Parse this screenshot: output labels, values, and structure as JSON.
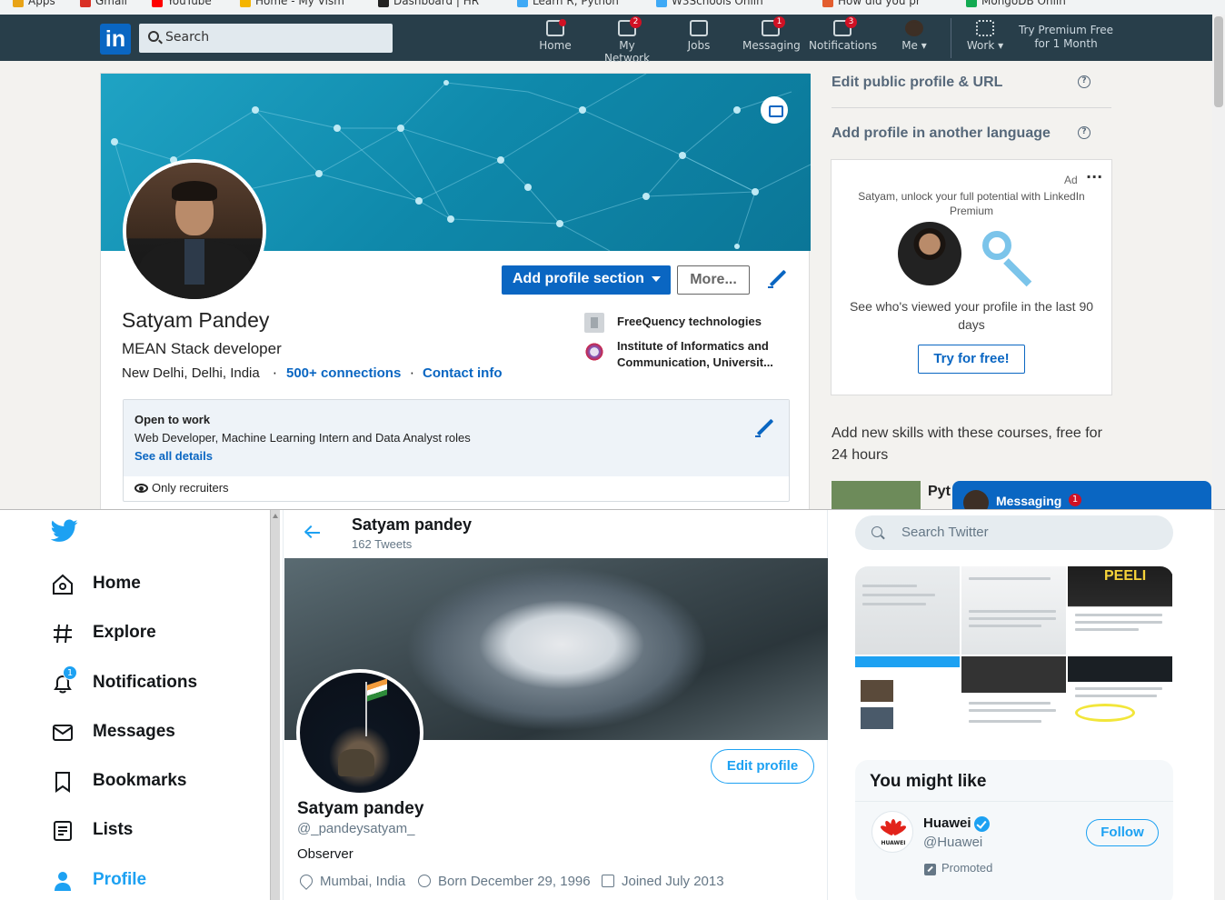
{
  "bookmarks": [
    {
      "label": "Apps",
      "color": "#e8a317"
    },
    {
      "label": "Gmail",
      "color": "#d93025"
    },
    {
      "label": "YouTube",
      "color": "#ff0000"
    },
    {
      "label": "Home - My Vism",
      "color": "#f4b400"
    },
    {
      "label": "Dashboard | HR",
      "color": "#222222"
    },
    {
      "label": "Learn R, Python",
      "color": "#3fa9f5"
    },
    {
      "label": "W3Schools Onlin",
      "color": "#3fa9f5"
    },
    {
      "label": "How did you pr",
      "color": "#e35d2f"
    },
    {
      "label": "MongoDB Onlin",
      "color": "#13aa52"
    }
  ],
  "linkedin": {
    "logo": "in",
    "search_placeholder": "Search",
    "nav": [
      {
        "label": "Home",
        "badge": "",
        "dot": true
      },
      {
        "label": "My Network",
        "badge": "2"
      },
      {
        "label": "Jobs",
        "badge": ""
      },
      {
        "label": "Messaging",
        "badge": "1"
      },
      {
        "label": "Notifications",
        "badge": "3"
      },
      {
        "label": "Me",
        "badge": ""
      },
      {
        "label": "Work",
        "badge": ""
      }
    ],
    "premium_cta": "Try Premium Free for 1 Month",
    "profile": {
      "name": "Satyam Pandey",
      "headline": "MEAN Stack developer",
      "location": "New Delhi, Delhi, India",
      "connections": "500+ connections",
      "contact": "Contact info",
      "separator": "·",
      "add_section": "Add profile section",
      "more": "More...",
      "companies": [
        "FreeQuency technologies",
        "Institute of Informatics and Communication, Universit..."
      ],
      "open_to_work": {
        "title": "Open to work",
        "roles": "Web Developer, Machine Learning Intern and Data Analyst roles",
        "link": "See all details",
        "visibility": "Only recruiters"
      }
    },
    "rail": {
      "edit_url": "Edit public profile & URL",
      "add_language": "Add profile in another language",
      "help": "?",
      "ad_label": "Ad",
      "ad_menu": "···",
      "ad_text": "Satyam, unlock your full potential with LinkedIn Premium",
      "ad_body": "See who's viewed your profile in the last 90 days",
      "ad_cta": "Try for free!",
      "courses": "Add new skills with these courses, free for 24 hours",
      "course_title": "Pyt"
    },
    "messaging": {
      "label": "Messaging",
      "badge": "1"
    }
  },
  "twitter": {
    "nav": [
      {
        "label": "Home",
        "icon": "home-icon"
      },
      {
        "label": "Explore",
        "icon": "hashtag-icon"
      },
      {
        "label": "Notifications",
        "icon": "bell-icon",
        "badge": "1"
      },
      {
        "label": "Messages",
        "icon": "envelope-icon"
      },
      {
        "label": "Bookmarks",
        "icon": "bookmark-icon"
      },
      {
        "label": "Lists",
        "icon": "list-icon"
      },
      {
        "label": "Profile",
        "icon": "person-icon",
        "active": true
      }
    ],
    "header": {
      "name": "Satyam pandey",
      "tweets": "162 Tweets"
    },
    "profile": {
      "name": "Satyam pandey",
      "handle": "@_pandeysatyam_",
      "bio": "Observer",
      "location": "Mumbai, India",
      "born": "Born December 29, 1996",
      "joined": "Joined July 2013",
      "edit": "Edit profile"
    },
    "search_placeholder": "Search Twitter",
    "media_overlay_text": "PEELI",
    "you_might_like": {
      "title": "You might like",
      "account": {
        "name": "Huawei",
        "handle": "@Huawei",
        "logo_text": "HUAWEI",
        "follow": "Follow",
        "promoted": "Promoted"
      }
    },
    "accent": "#1da1f2"
  }
}
